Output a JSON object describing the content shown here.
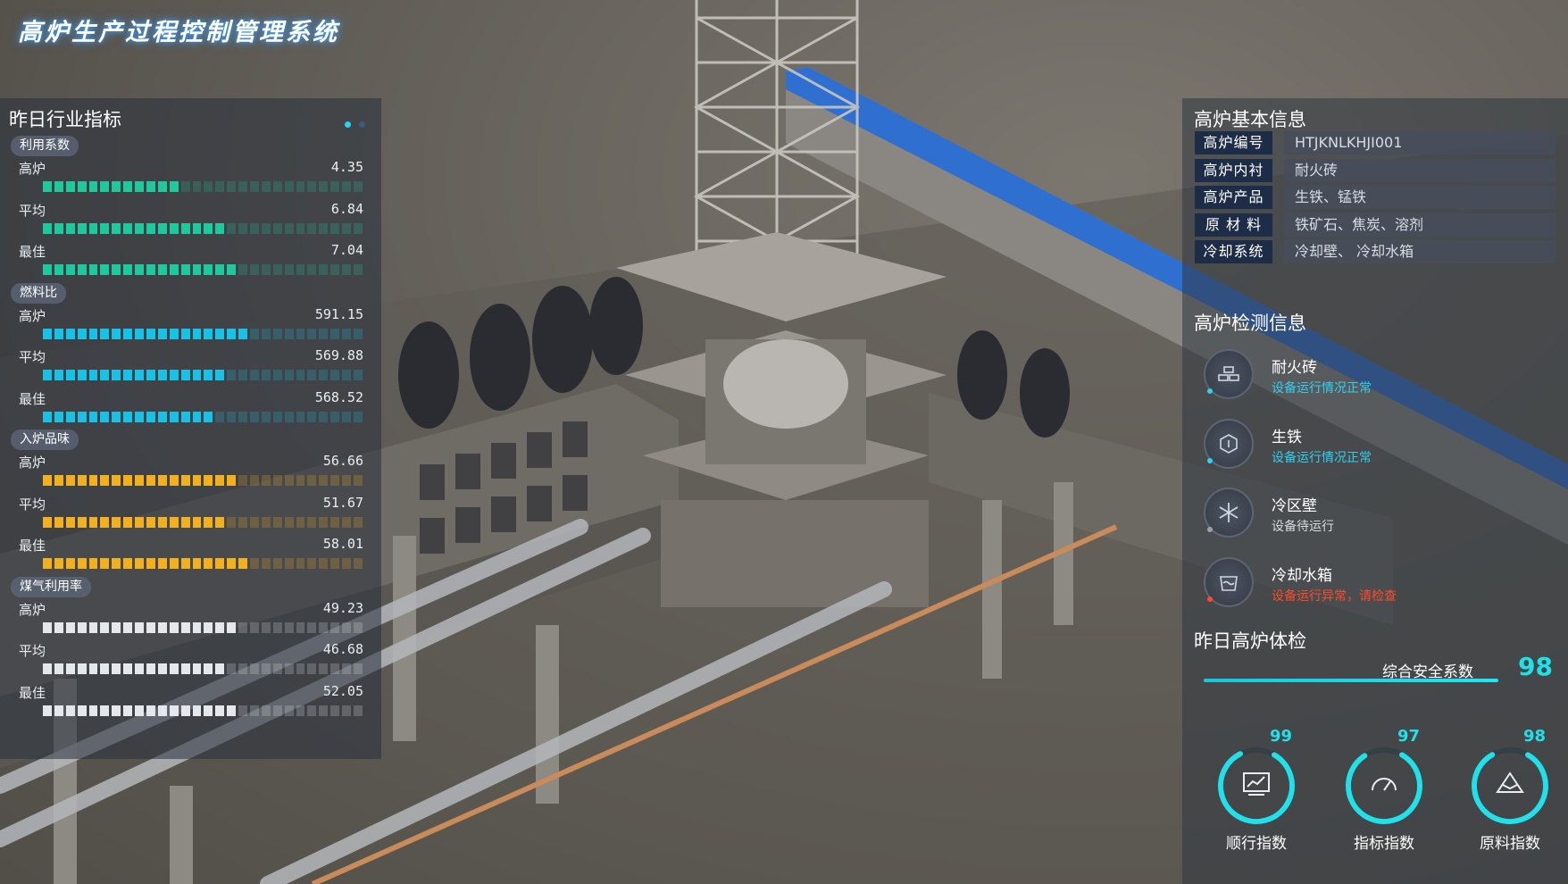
{
  "app": {
    "title": "高炉生产过程控制管理系统"
  },
  "colors": {
    "teal": "#1ec99e",
    "cyan": "#17c2e6",
    "amber": "#f2b01e",
    "white": "#e4e8ec",
    "accent": "#22e0ea",
    "error": "#ff4a2a",
    "ok": "#2fd1f0"
  },
  "left": {
    "title": "昨日行业指标",
    "groups": [
      {
        "tag": "利用系数",
        "color": "teal",
        "rows": [
          {
            "label": "高炉",
            "value": "4.35",
            "fill": 0.44
          },
          {
            "label": "平均",
            "value": "6.84",
            "fill": 0.56
          },
          {
            "label": "最佳",
            "value": "7.04",
            "fill": 0.6
          }
        ]
      },
      {
        "tag": "燃料比",
        "color": "cyan",
        "rows": [
          {
            "label": "高炉",
            "value": "591.15",
            "fill": 0.66
          },
          {
            "label": "平均",
            "value": "569.88",
            "fill": 0.56
          },
          {
            "label": "最佳",
            "value": "568.52",
            "fill": 0.54
          }
        ]
      },
      {
        "tag": "入炉品味",
        "color": "amber",
        "rows": [
          {
            "label": "高炉",
            "value": "56.66",
            "fill": 0.6
          },
          {
            "label": "平均",
            "value": "51.67",
            "fill": 0.56
          },
          {
            "label": "最佳",
            "value": "58.01",
            "fill": 0.64
          }
        ]
      },
      {
        "tag": "煤气利用率",
        "color": "white",
        "rows": [
          {
            "label": "高炉",
            "value": "49.23",
            "fill": 0.6
          },
          {
            "label": "平均",
            "value": "46.68",
            "fill": 0.56
          },
          {
            "label": "最佳",
            "value": "52.05",
            "fill": 0.6
          }
        ]
      }
    ]
  },
  "right": {
    "basic_title": "高炉基本信息",
    "basic": [
      {
        "key": "高炉编号",
        "value": "HTJKNLKHJI001"
      },
      {
        "key": "高炉内衬",
        "value": "耐火砖"
      },
      {
        "key": "高炉产品",
        "value": "生铁、锰铁"
      },
      {
        "key": "原 材 料",
        "value": "铁矿石、焦炭、溶剂"
      },
      {
        "key": "冷却系统",
        "value": "冷却壁、 冷却水箱"
      }
    ],
    "detect_title": "高炉检测信息",
    "detect": [
      {
        "name": "耐火砖",
        "status": "设备运行情况正常",
        "state": "ok",
        "icon": "brick-icon"
      },
      {
        "name": "生铁",
        "status": "设备运行情况正常",
        "state": "ok",
        "icon": "hexagon-icon"
      },
      {
        "name": "冷区壁",
        "status": "设备待运行",
        "state": "idle",
        "icon": "snowflake-icon"
      },
      {
        "name": "冷却水箱",
        "status": "设备运行异常，请检查",
        "state": "error",
        "icon": "water-tank-icon"
      }
    ],
    "check_title": "昨日高炉体检",
    "safety_label": "综合安全系数",
    "safety_value": "98",
    "gauges": [
      {
        "label": "顺行指数",
        "value": "99",
        "icon": "chart-icon"
      },
      {
        "label": "指标指数",
        "value": "97",
        "icon": "speedometer-icon"
      },
      {
        "label": "原料指数",
        "value": "98",
        "icon": "ore-icon"
      }
    ]
  }
}
